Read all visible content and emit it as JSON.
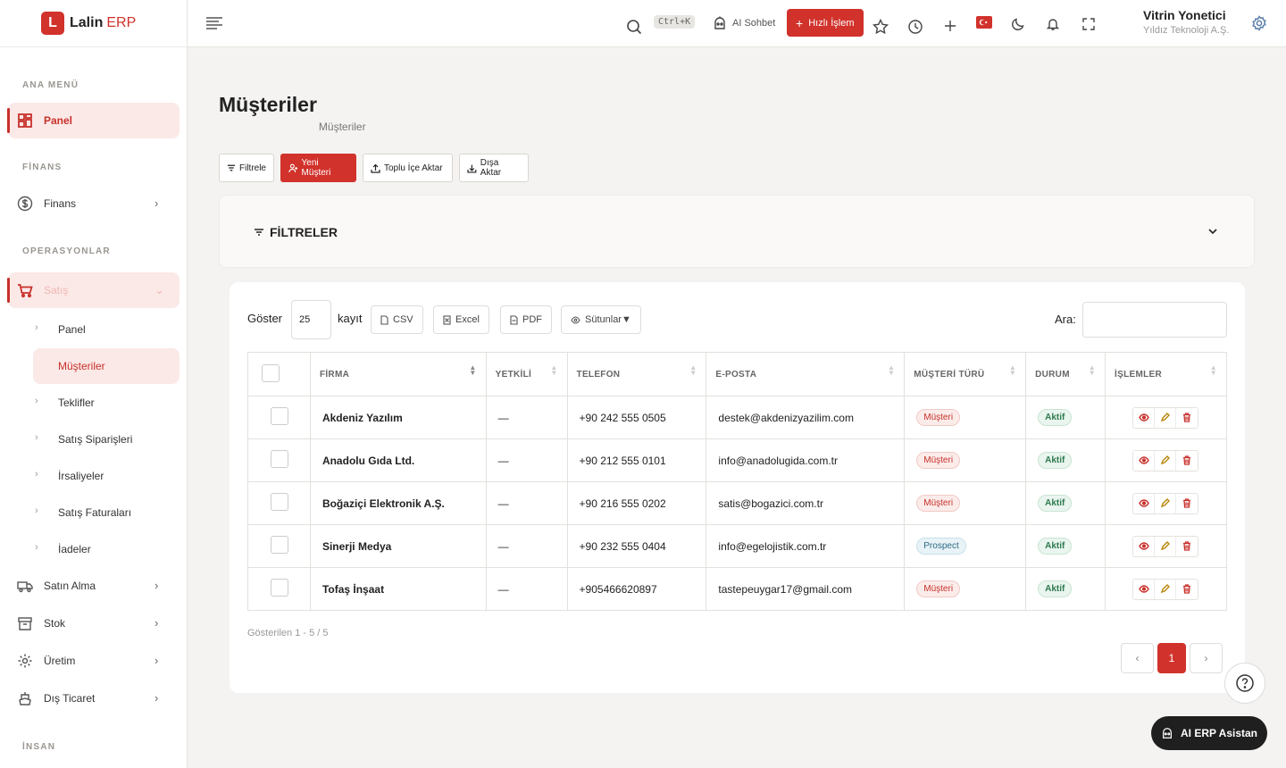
{
  "brand": {
    "logo_letter": "L",
    "name": "Lalin",
    "suffix": "ERP"
  },
  "sidebar": {
    "section_main": "ANA MENÜ",
    "section_finance": "FİNANS",
    "section_ops": "OPERASYONLAR",
    "section_hr": "İNSAN",
    "panel": "Panel",
    "finans": "Finans",
    "satis": "Satış",
    "sub": [
      "Panel",
      "Müşteriler",
      "Teklifler",
      "Satış Siparişleri",
      "İrsaliyeler",
      "Satış Faturaları",
      "İadeler"
    ],
    "satin_alma": "Satın Alma",
    "stok": "Stok",
    "uretim": "Üretim",
    "dis_ticaret": "Dış Ticaret"
  },
  "topbar": {
    "shortcut": "Ctrl+K",
    "ai_chat": "AI Sohbet",
    "quick_action": "Hızlı İşlem",
    "user_name": "Vitrin Yonetici",
    "user_company": "Yıldız Teknoloji A.Ş."
  },
  "page": {
    "title": "Müşteriler",
    "breadcrumb": [
      "Panel",
      "Satış",
      "Müşteriler"
    ],
    "actions": {
      "filter": "Filtrele",
      "new": "Yeni Müşteri",
      "import": "Toplu İçe Aktar",
      "export": "Dışa Aktar"
    },
    "filters_title": "FİLTRELER"
  },
  "table": {
    "show_label": "Göster",
    "page_size": "25",
    "records_label": "kayıt",
    "csv": "CSV",
    "excel": "Excel",
    "pdf": "PDF",
    "columns": "Sütunlar▼",
    "search_label": "Ara:",
    "headers": [
      "FİRMA",
      "YETKİLİ",
      "TELEFON",
      "E-POSTA",
      "MÜŞTERİ TÜRÜ",
      "DURUM",
      "İŞLEMLER"
    ],
    "rows": [
      {
        "firm": "Akdeniz Yazılım",
        "contact": "—",
        "phone": "+90 242 555 0505",
        "email": "destek@akdenizyazilim.com",
        "type": "Müşteri",
        "status": "Aktif"
      },
      {
        "firm": "Anadolu Gıda Ltd.",
        "contact": "—",
        "phone": "+90 212 555 0101",
        "email": "info@anadolugida.com.tr",
        "type": "Müşteri",
        "status": "Aktif"
      },
      {
        "firm": "Boğaziçi Elektronik A.Ş.",
        "contact": "—",
        "phone": "+90 216 555 0202",
        "email": "satis@bogazici.com.tr",
        "type": "Müşteri",
        "status": "Aktif"
      },
      {
        "firm": "Sinerji Medya",
        "contact": "—",
        "phone": "+90 232 555 0404",
        "email": "info@egelojistik.com.tr",
        "type": "Prospect",
        "status": "Aktif"
      },
      {
        "firm": "Tofaş İnşaat",
        "contact": "—",
        "phone": "+905466620897",
        "email": "tastepeuygar17@gmail.com",
        "type": "Müşteri",
        "status": "Aktif"
      }
    ],
    "footer_info": "Gösterilen 1 - 5 / 5",
    "current_page": "1",
    "prev": "‹",
    "next": "›"
  },
  "assistant": {
    "label": "AI ERP Asistan",
    "help": "?"
  },
  "colors": {
    "accent": "#d1322b",
    "accent_soft": "#fbe9e7"
  }
}
